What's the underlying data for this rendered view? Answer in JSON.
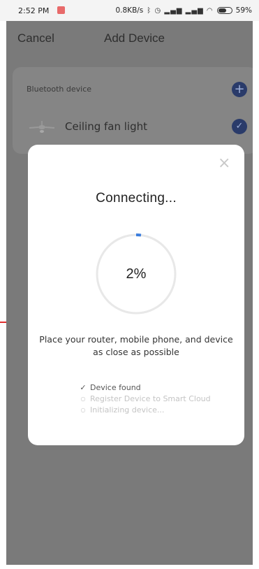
{
  "status_bar": {
    "time": "2:52 PM",
    "network_speed": "0.8KB/s",
    "battery_percent": "59%",
    "icons": [
      "bluetooth-icon",
      "alarm-icon",
      "signal-icon",
      "signal-icon",
      "wifi-icon",
      "battery-icon"
    ]
  },
  "nav": {
    "cancel_label": "Cancel",
    "title": "Add Device"
  },
  "device_card": {
    "header": "Bluetooth device",
    "device_name": "Ceiling fan light",
    "add_icon": "plus-circle-icon",
    "selected_icon": "check-circle-icon"
  },
  "modal": {
    "title": "Connecting...",
    "progress_value": 0.02,
    "progress_text": "2%",
    "hint": "Place your router, mobile phone, and device as close as possible",
    "steps": [
      {
        "label": "Device found",
        "status": "done"
      },
      {
        "label": "Register Device to Smart Cloud",
        "status": "pending"
      },
      {
        "label": "Initializing device...",
        "status": "pending"
      }
    ]
  },
  "colors": {
    "overlay": "#7a7a7a",
    "accent": "#2a3b6a",
    "progress": "#3b7ddd",
    "ring_track": "#e8e8e8"
  }
}
